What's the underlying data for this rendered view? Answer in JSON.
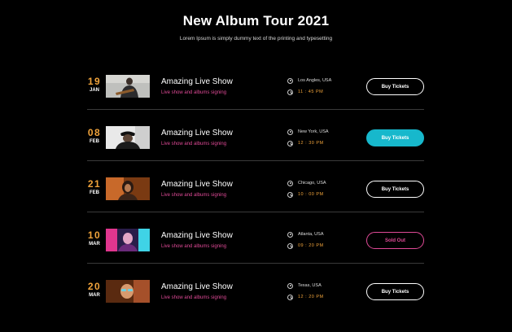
{
  "header": {
    "title": "New Album Tour 2021",
    "subtitle": "Lorem Ipsum is simply dummy text of the printing and typesetting"
  },
  "colors": {
    "accent_date": "#f0a33b",
    "accent_pink": "#e04a97",
    "accent_teal": "#17b8cc",
    "background": "#000000"
  },
  "events": [
    {
      "day": "19",
      "month": "JAN",
      "title": "Amazing Live Show",
      "subtitle": "Live show and albums signing",
      "location": "Los Angles, USA",
      "time": "11 : 45 PM",
      "button": "Buy Tickets",
      "button_style": "outline"
    },
    {
      "day": "08",
      "month": "FEB",
      "title": "Amazing Live Show",
      "subtitle": "Live show and albums signing",
      "location": "New York, USA",
      "time": "12 : 30 PM",
      "button": "Buy Tickets",
      "button_style": "filled"
    },
    {
      "day": "21",
      "month": "FEB",
      "title": "Amazing Live Show",
      "subtitle": "Live show and albums signing",
      "location": "Chicago, USA",
      "time": "10 : 00 PM",
      "button": "Buy Tickets",
      "button_style": "outline"
    },
    {
      "day": "10",
      "month": "MAR",
      "title": "Amazing Live Show",
      "subtitle": "Live show and albums signing",
      "location": "Atlanta, USA",
      "time": "09 : 20 PM",
      "button": "Sold Out",
      "button_style": "soldout"
    },
    {
      "day": "20",
      "month": "MAR",
      "title": "Amazing Live Show",
      "subtitle": "Live show and albums signing",
      "location": "Texas, USA",
      "time": "12 : 20 PM",
      "button": "Buy Tickets",
      "button_style": "outline"
    }
  ],
  "icons": {
    "location": "location-pin-icon",
    "time": "clock-icon"
  }
}
